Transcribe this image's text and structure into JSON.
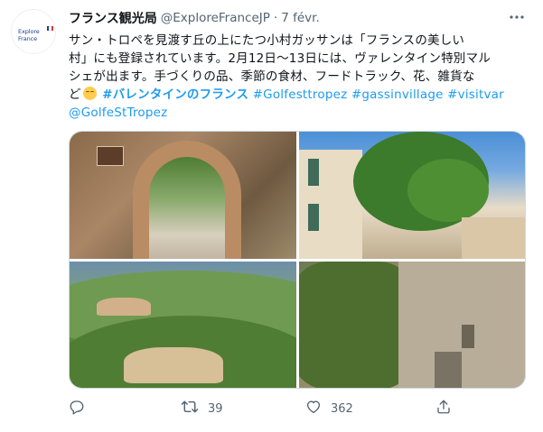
{
  "tweet": {
    "avatar": {
      "logo_line1": "Explore",
      "logo_line2": "France",
      "flag_colors": [
        "#1c3f8f",
        "#ffffff",
        "#e1333b"
      ]
    },
    "display_name": "フランス観光局",
    "handle": "@ExploreFranceJP",
    "separator": "·",
    "timestamp": "7 févr.",
    "text": {
      "line1": "サン・トロペを見渡す丘の上にたつ小村ガッサンは「フランスの美しい",
      "line2": "村」にも登録されています。2月12日〜13日には、ヴァレンタイン特別マル",
      "line3": "シェが出ます。手づくりの品、季節の食材、フードトラック、花、雑貨な",
      "line4_prefix": "ど",
      "emoji": "relieved-face",
      "hashtag1": "#バレンタインのフランス",
      "hashtag2": "#Golfesttropez",
      "hashtag3": "#gassinvillage",
      "hashtag4": "#visitvar",
      "mention": "@GolfeStTropez"
    },
    "media": [
      {
        "alt": "stone-archway-photo"
      },
      {
        "alt": "village-street-with-trees-photo"
      },
      {
        "alt": "hilltop-village-aerial-photo"
      },
      {
        "alt": "stone-houses-with-ivy-photo"
      }
    ],
    "actions": {
      "reply_count": "",
      "retweet_count": "39",
      "like_count": "362",
      "share_count": ""
    },
    "colors": {
      "accent": "#1d9bf0",
      "text": "#0f1419",
      "secondary": "#536471"
    }
  }
}
